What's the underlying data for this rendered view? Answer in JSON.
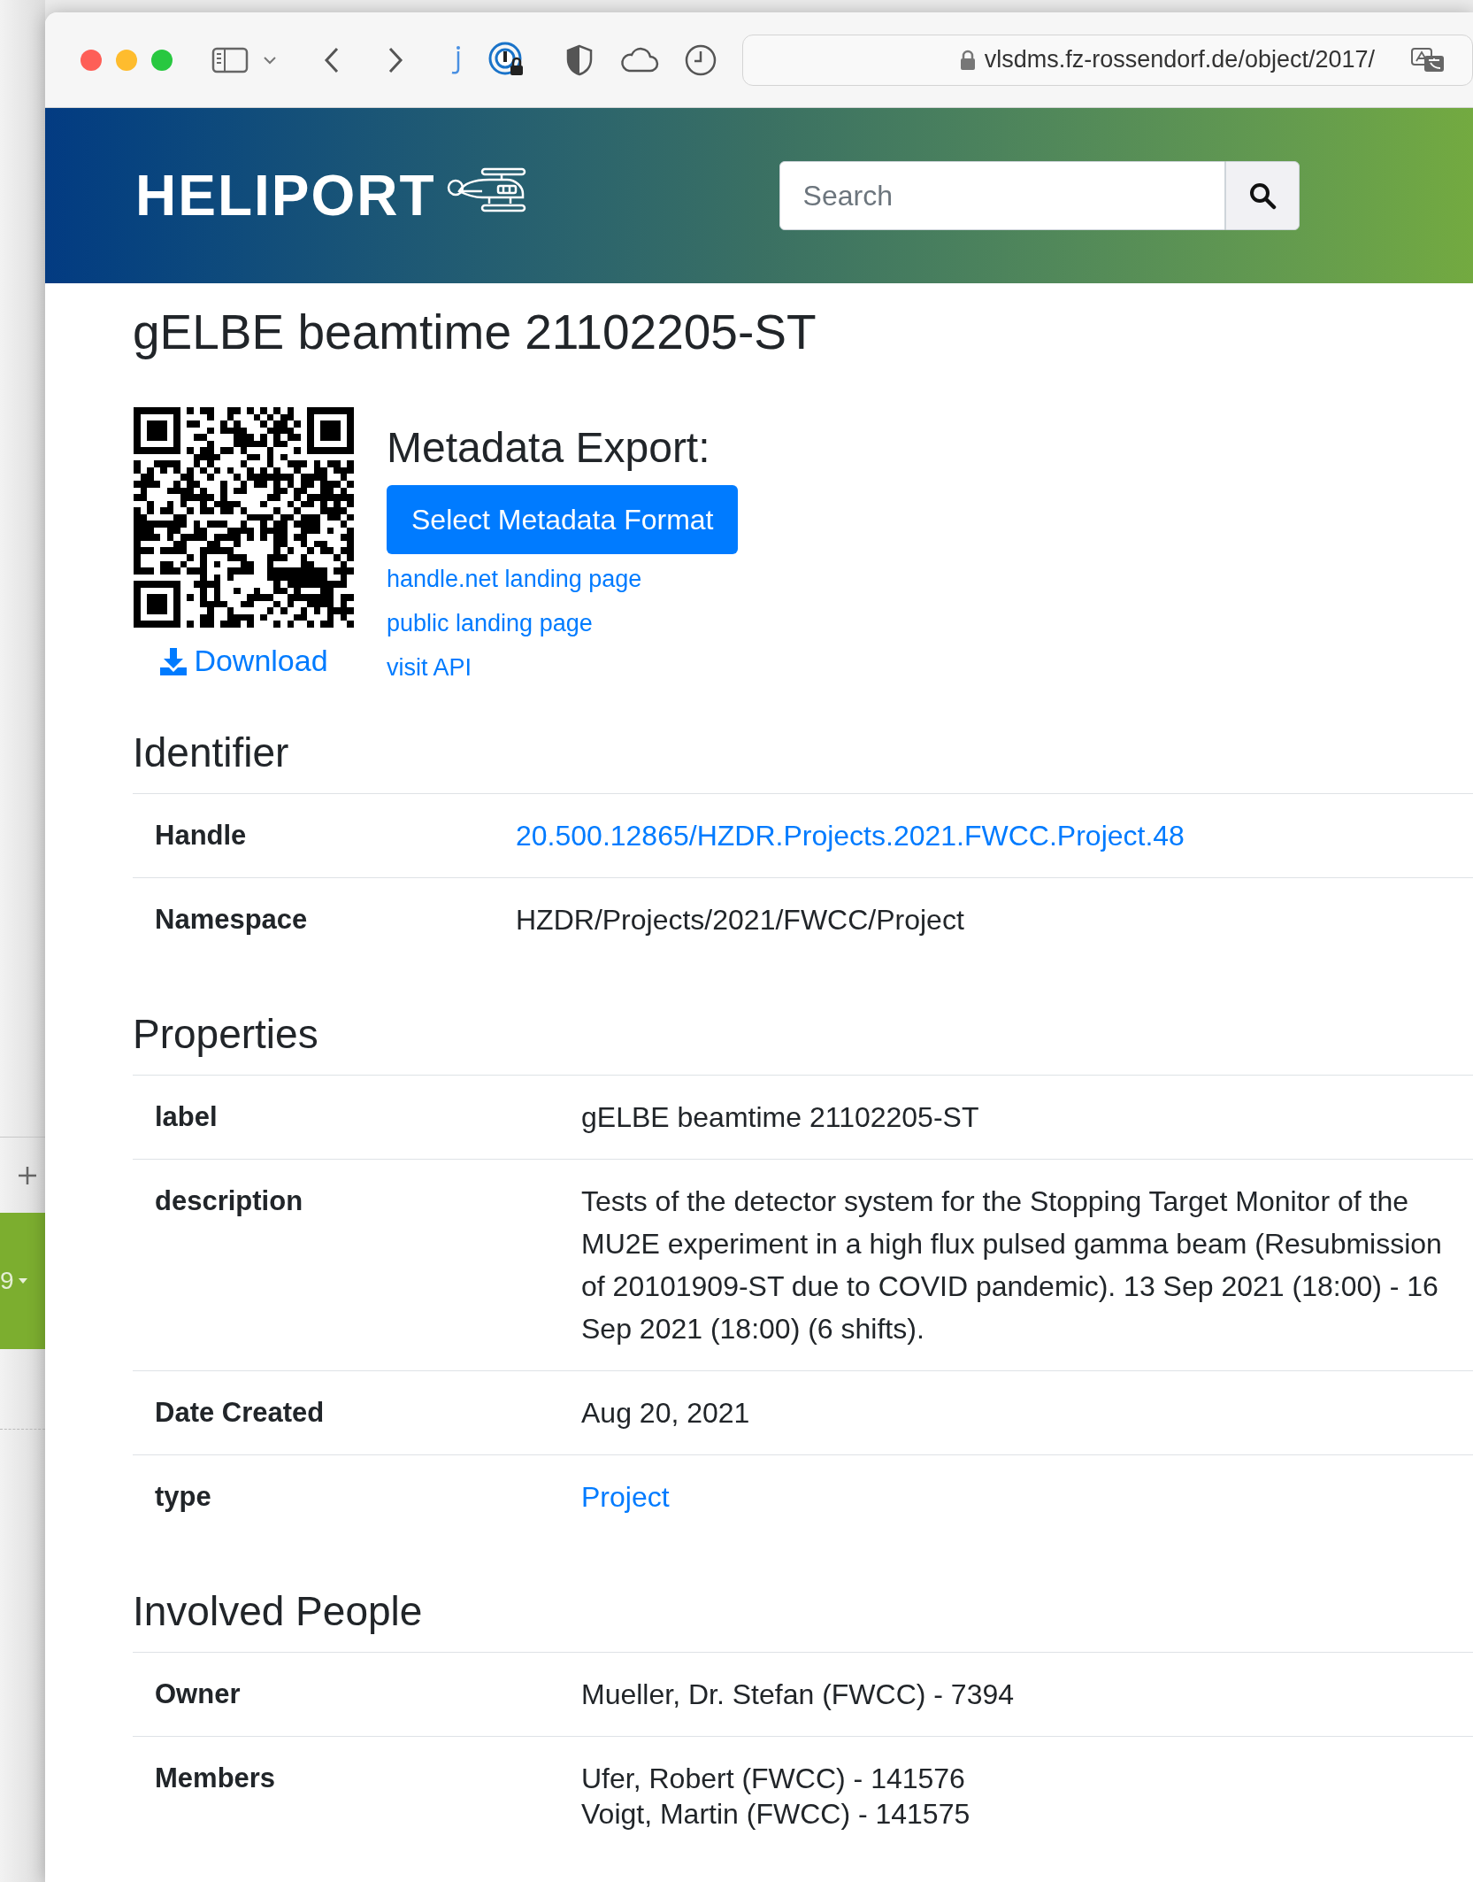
{
  "browser": {
    "url": "vlsdms.fz-rossendorf.de/object/2017/"
  },
  "side_panel": {
    "badge": "9"
  },
  "header": {
    "logo": "HELIPORT",
    "search": {
      "placeholder": "Search"
    }
  },
  "title": "gELBE beamtime 21102205-ST",
  "qr": {
    "download": "Download"
  },
  "export": {
    "heading": "Metadata Export:",
    "button": "Select Metadata Format",
    "links": [
      "handle.net landing page",
      "public landing page",
      "visit API"
    ]
  },
  "sections": [
    {
      "heading": "Identifier",
      "rows": [
        {
          "label": "Handle",
          "kind": "link",
          "values": [
            "20.500.12865/HZDR.Projects.2021.FWCC.Project.48"
          ]
        },
        {
          "label": "Namespace",
          "kind": "text",
          "values": [
            "HZDR/Projects/2021/FWCC/Project"
          ]
        }
      ]
    },
    {
      "heading": "Properties",
      "rows": [
        {
          "label": "label",
          "kind": "text",
          "values": [
            "gELBE beamtime 21102205-ST"
          ]
        },
        {
          "label": "description",
          "kind": "text",
          "values": [
            "Tests of the detector system for the Stopping Target Monitor of the MU2E experiment in a high flux pulsed gamma beam (Resubmission of 20101909-ST due to COVID pandemic). 13 Sep 2021 (18:00) - 16 Sep 2021 (18:00) (6 shifts)."
          ]
        },
        {
          "label": "Date Created",
          "kind": "text",
          "values": [
            "Aug 20, 2021"
          ]
        },
        {
          "label": "type",
          "kind": "link",
          "values": [
            "Project"
          ]
        }
      ]
    },
    {
      "heading": "Involved People",
      "rows": [
        {
          "label": "Owner",
          "kind": "text",
          "values": [
            "Mueller, Dr. Stefan (FWCC) - 7394"
          ]
        },
        {
          "label": "Members",
          "kind": "text",
          "values": [
            "Ufer, Robert (FWCC) - 141576",
            "Voigt, Martin (FWCC) - 141575"
          ]
        }
      ]
    }
  ]
}
